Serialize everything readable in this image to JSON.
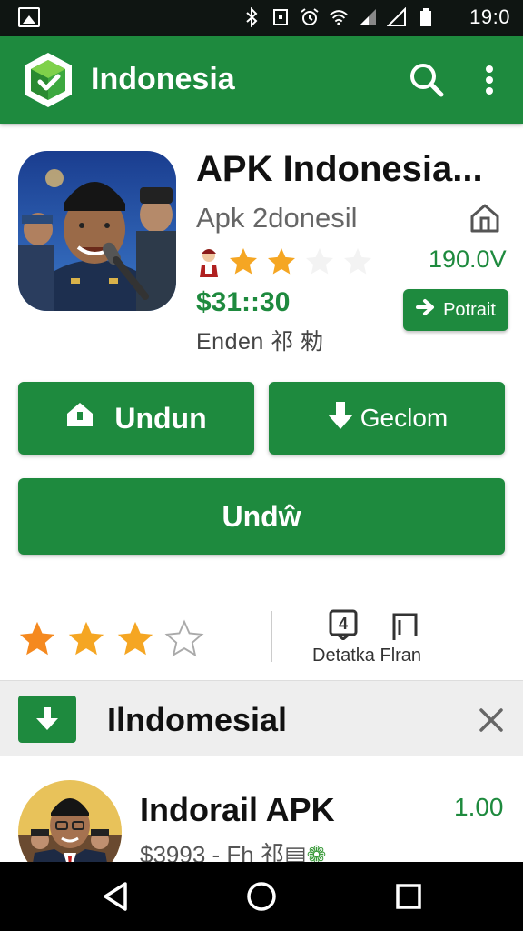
{
  "status_bar": {
    "time": "19:0",
    "icons": [
      "image-icon",
      "bluetooth-icon",
      "vibrate-icon",
      "alarm-icon",
      "wifi-icon",
      "signal-icon",
      "signal-icon",
      "battery-icon"
    ]
  },
  "app_bar": {
    "title": "Indonesia",
    "icons": [
      "app-logo-icon",
      "search-icon",
      "more-vert-icon"
    ]
  },
  "app": {
    "name": "APK Indonesia...",
    "developer": "Apk 2donesil",
    "version": "190.0V",
    "price": "$31::30",
    "extra": "Enden 祁 勑",
    "rating_stars": 2,
    "portrait_label": "Potrait"
  },
  "actions": {
    "primary_left": "Undun",
    "primary_right": "Geclom",
    "wide": "Undŵ"
  },
  "rating_summary": {
    "stars": 3,
    "max_stars": 4,
    "detail_badge": "4",
    "detail_label": "Detatka Flran"
  },
  "banner": {
    "title": "Ilndomesial"
  },
  "list": {
    "items": [
      {
        "title": "Indorail APK",
        "version": "1.00",
        "subtitle": "$3993 - Fh 祁"
      }
    ]
  },
  "colors": {
    "primary": "#1e8a3e",
    "star": "#f5a623",
    "status_bar": "#0f1512"
  }
}
